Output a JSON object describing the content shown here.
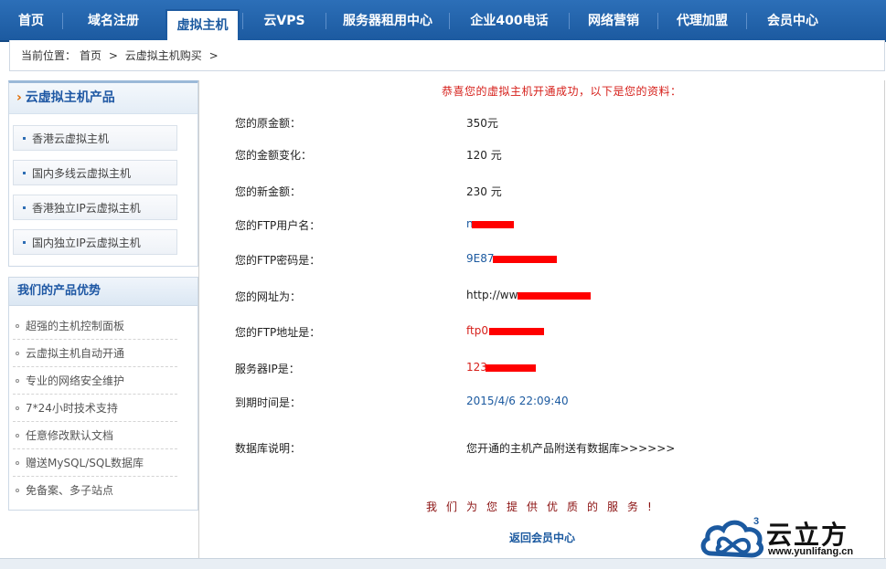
{
  "nav": {
    "items": [
      "首页",
      "域名注册",
      "虚拟主机",
      "云VPS",
      "服务器租用中心",
      "企业400电话",
      "网络营销",
      "代理加盟",
      "会员中心"
    ],
    "active": "虚拟主机"
  },
  "breadcrumb": {
    "prefix": "当前位置：",
    "home": "首页",
    "sep1": ">",
    "current": "云虚拟主机购买",
    "sep2": ">"
  },
  "sidebar": {
    "products_title": "云虚拟主机产品",
    "products": [
      "香港云虚拟主机",
      "国内多线云虚拟主机",
      "香港独立IP云虚拟主机",
      "国内独立IP云虚拟主机"
    ],
    "advantages_title": "我们的产品优势",
    "advantages": [
      "超强的主机控制面板",
      "云虚拟主机自动开通",
      "专业的网络安全维护",
      "7*24小时技术支持",
      "任意修改默认文档",
      "赠送MySQL/SQL数据库",
      "免备案、多子站点"
    ]
  },
  "main": {
    "success_message": "恭喜您的虚拟主机开通成功，以下是您的资料：",
    "rows": [
      {
        "label": "您的原金额：",
        "value": "350元"
      },
      {
        "label": "您的金额变化：",
        "value": "120 元"
      },
      {
        "label": "您的新金额：",
        "value": "230 元"
      },
      {
        "label": "您的FTP用户名：",
        "value": "n"
      },
      {
        "label": "您的FTP密码是：",
        "value": "9E87"
      },
      {
        "label": "您的网址为：",
        "value": "http://ww"
      },
      {
        "label": "您的FTP地址是：",
        "value": "ftp0"
      },
      {
        "label": "服务器IP是：",
        "value": "123"
      },
      {
        "label": "到期时间是：",
        "value": "2015/4/6 22:09:40"
      },
      {
        "label": "数据库说明：",
        "value": "您开通的主机产品附送有数据库>>>>>>"
      }
    ],
    "service_text": "我们为您提供优质的服务!",
    "back_link": "返回会员中心"
  },
  "watermark": {
    "brand": "云立方",
    "url": "www.yunlifang.cn",
    "sup": "3"
  },
  "colors": {
    "nav_bg": "#1c5aa0",
    "accent_red": "#d6201b",
    "link_blue": "#1c5aa0"
  }
}
